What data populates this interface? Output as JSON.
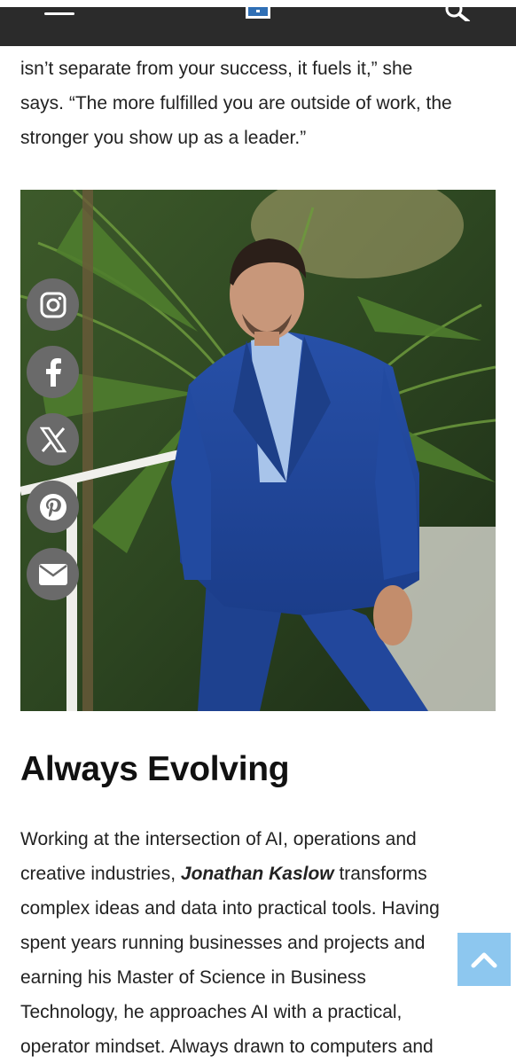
{
  "header": {
    "menu_icon": "hamburger-menu-icon",
    "logo_icon": "site-logo-icon",
    "search_icon": "search-icon",
    "background": "#2b2b2b"
  },
  "article": {
    "quote_lines": [
      "isn’t separate from your success, it fuels it,” she",
      "says. “The more fulfilled you are outside of work, the",
      "stronger you show up as a leader.”"
    ],
    "heading": "Always Evolving",
    "para_lines": [
      {
        "pre": "Working at the intersection of AI, operations and",
        "bold": "",
        "post": ""
      },
      {
        "pre": "creative industries, ",
        "bold": "Jonathan Kaslow",
        "post": " transforms"
      },
      {
        "pre": "complex ideas and data into practical tools. Having",
        "bold": "",
        "post": ""
      },
      {
        "pre": "spent years running businesses and projects and",
        "bold": "",
        "post": ""
      },
      {
        "pre": "earning his Master of Science in Business",
        "bold": "",
        "post": ""
      },
      {
        "pre": "Technology, he approaches AI with a practical,",
        "bold": "",
        "post": ""
      },
      {
        "pre": "operator mindset. Always drawn to computers and",
        "bold": "",
        "post": ""
      }
    ]
  },
  "share_bar": [
    {
      "name": "instagram-icon"
    },
    {
      "name": "facebook-icon"
    },
    {
      "name": "x-twitter-icon"
    },
    {
      "name": "pinterest-icon"
    },
    {
      "name": "email-icon"
    }
  ],
  "back_to_top": {
    "icon": "chevron-up-icon",
    "color": "#8dc7ef"
  }
}
